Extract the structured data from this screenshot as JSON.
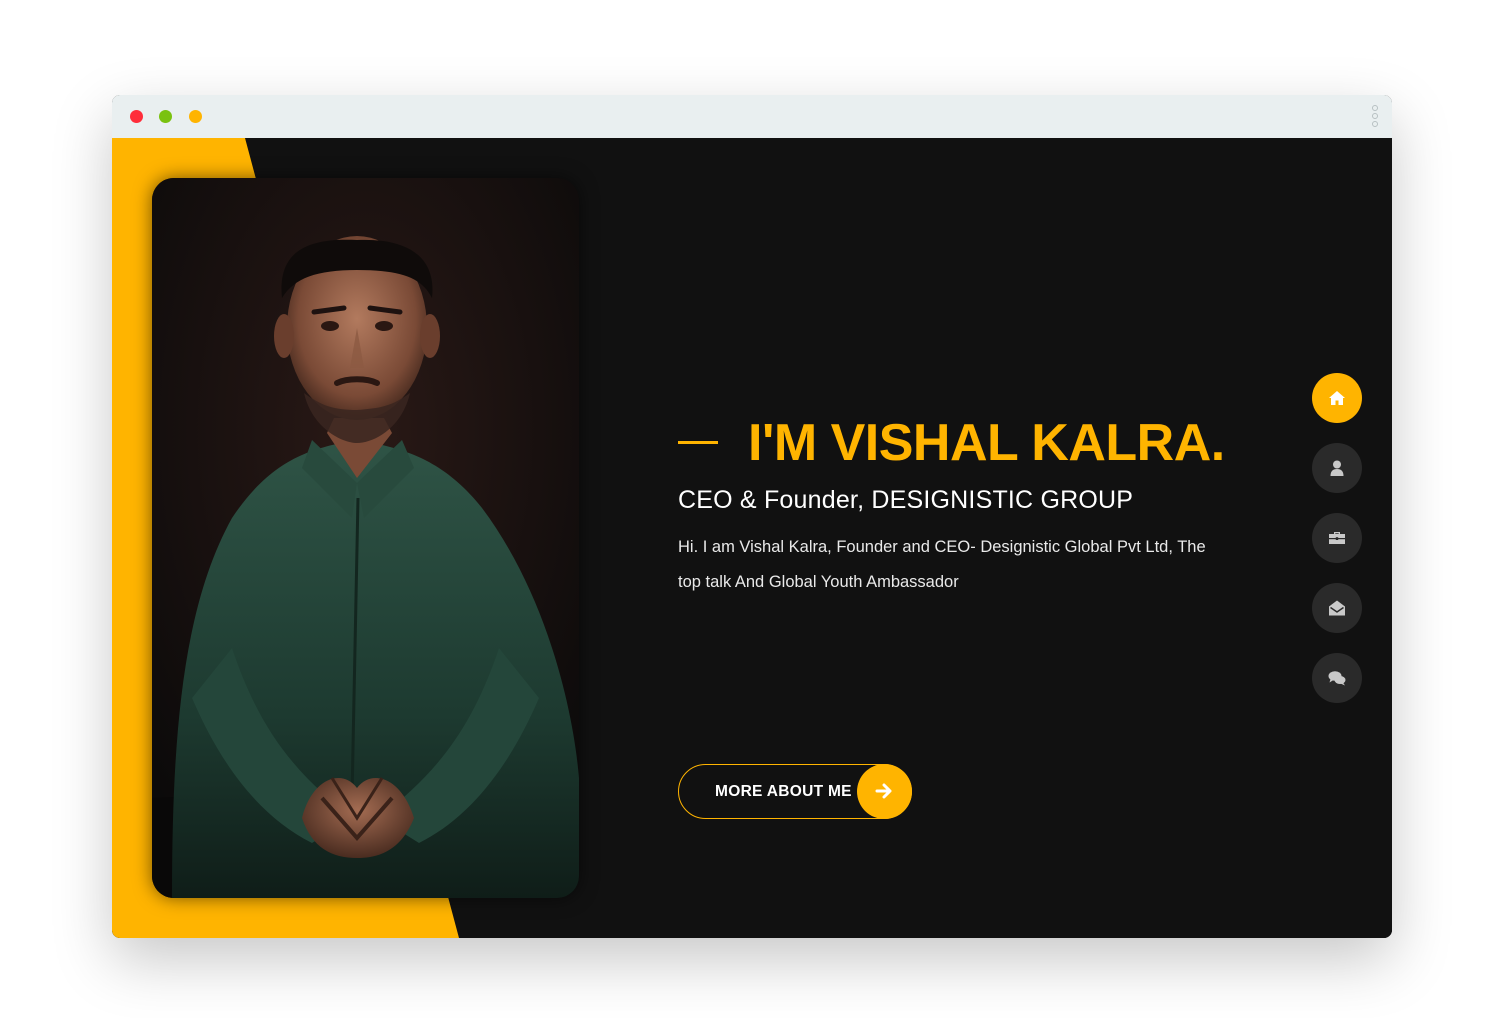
{
  "window": {
    "controls": [
      "close",
      "minimize",
      "maximize"
    ],
    "control_colors": {
      "close": "#ff2d3a",
      "minimize": "#7ac20f",
      "maximize": "#ffb400"
    }
  },
  "theme": {
    "accent": "#ffb400",
    "background": "#111111",
    "nav_inactive": "#2a2a2a",
    "nav_icon_inactive": "#c9c9c9"
  },
  "hero": {
    "name": "I'M VISHAL KALRA.",
    "subtitle": "CEO & Founder, DESIGNISTIC GROUP",
    "description": "Hi. I am Vishal Kalra, Founder and CEO- Designistic Global Pvt Ltd, The top talk And Global Youth Ambassador",
    "cta_label": "MORE ABOUT ME",
    "cta_icon": "arrow-right-icon"
  },
  "side_nav": {
    "items": [
      {
        "name": "home",
        "icon": "home-icon",
        "active": true
      },
      {
        "name": "about",
        "icon": "user-icon",
        "active": false
      },
      {
        "name": "portfolio",
        "icon": "briefcase-icon",
        "active": false
      },
      {
        "name": "contact",
        "icon": "envelope-open-icon",
        "active": false
      },
      {
        "name": "blog",
        "icon": "comments-icon",
        "active": false
      }
    ]
  }
}
